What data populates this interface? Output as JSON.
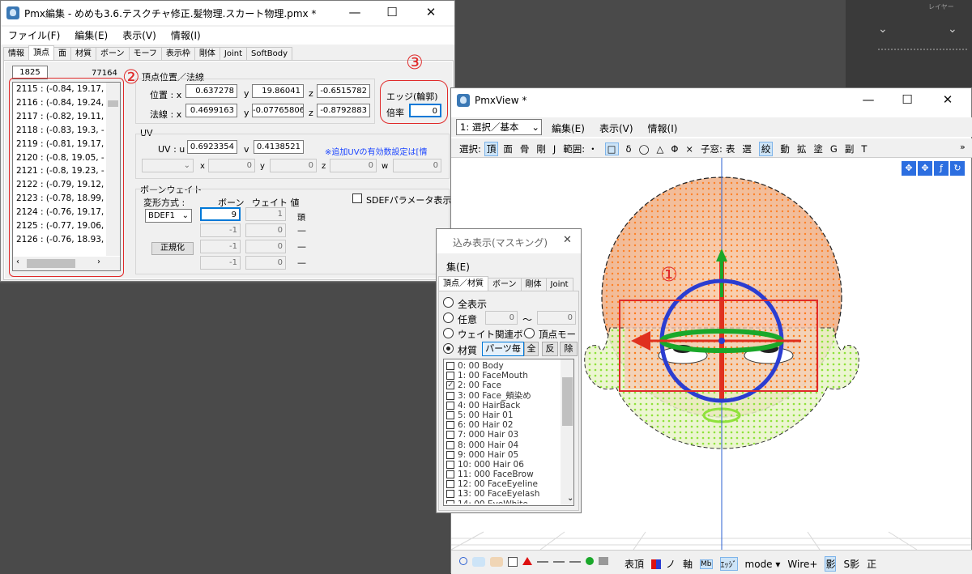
{
  "colors": {
    "annotation": "#e02a2a",
    "accent": "#0078d7"
  },
  "bg_panel": {
    "title": "レイヤー"
  },
  "pmx": {
    "title": "Pmx編集 - めめも3.6.テスクチャ修正.髪物理.スカート物理.pmx *",
    "menu": [
      "ファイル(F)",
      "編集(E)",
      "表示(V)",
      "情報(I)"
    ],
    "tabs": [
      "情報",
      "頂点",
      "面",
      "材質",
      "ボーン",
      "モーフ",
      "表示枠",
      "剛体",
      "Joint",
      "SoftBody"
    ],
    "index_value": "1825",
    "count": "77164",
    "vertices": [
      "2115 : (-0.84, 19.17, -",
      "2116 : (-0.84, 19.24, -",
      "2117 : (-0.82, 19.11, -",
      "2118 : (-0.83, 19.3, -",
      "2119 : (-0.81, 19.17, -",
      "2120 : (-0.8, 19.05, -",
      "2121 : (-0.8, 19.23, -",
      "2122 : (-0.79, 19.12, -",
      "2123 : (-0.78, 18.99, -",
      "2124 : (-0.76, 19.17, -",
      "2125 : (-0.77, 19.06, -",
      "2126 : (-0.76, 18.93, -"
    ],
    "pos": {
      "header": "頂点位置／法線",
      "pos_label": "位置 : x",
      "norm_label": "法線 : x",
      "x": "0.637278",
      "y": "19.86041",
      "z": "-0.6515782",
      "nx": "0.4699163",
      "ny": "-0.07765806",
      "nz": "-0.8792883"
    },
    "edge": {
      "label": "エッジ(輪郭)",
      "rate_label": "倍率",
      "rate": "0"
    },
    "uv": {
      "header": "UV",
      "label": "UV : u",
      "u": "0.6923354",
      "v": "0.4138521",
      "note": "※追加UVの有効数設定は[情",
      "x": "0",
      "y": "0",
      "z": "0",
      "w": "0"
    },
    "weight": {
      "header": "ボーンウェイト",
      "method_label": "変形方式 :",
      "bone_col": "ボーン",
      "weight_col": "ウェイト 値",
      "method": "BDEF1",
      "normalize": "正規化",
      "sdef": "SDEFパラメータ表示",
      "rows": [
        {
          "bone": "9",
          "w": "1",
          "name": "頭"
        },
        {
          "bone": "-1",
          "w": "0",
          "name": "—"
        },
        {
          "bone": "-1",
          "w": "0",
          "name": "—"
        },
        {
          "bone": "-1",
          "w": "0",
          "name": "—"
        }
      ]
    },
    "axis_labels": {
      "x": "x",
      "y": "y",
      "z": "z",
      "w": "w",
      "v": "v"
    }
  },
  "view": {
    "title": "PmxView *",
    "mode_select": "1: 選択／基本",
    "menu": [
      "編集(E)",
      "表示(V)",
      "情報(I)"
    ],
    "toolbar": [
      "選択:",
      "頂",
      "面",
      "骨",
      "剛",
      "J",
      "範囲:",
      "・",
      "□",
      "δ",
      "◯",
      "△",
      "Φ",
      "×",
      "子窓:",
      "表",
      "選",
      "絞",
      "動",
      "拡",
      "塗",
      "G",
      "副",
      "T"
    ],
    "bottom": [
      "表頂",
      "ノ",
      "軸",
      "Mb",
      "ｴｯｼﾞ",
      "mode ▾",
      "Wire+",
      "影",
      "S影",
      "正"
    ]
  },
  "mask": {
    "title": "込み表示(マスキング)",
    "menu": "集(E)",
    "tabs": [
      "頂点／材質",
      "ボーン",
      "剛体",
      "Joint"
    ],
    "all_label": "全表示",
    "any_label": "任意",
    "any_from": "0",
    "range_sep": "～",
    "any_to": "0",
    "weight_label": "ウェイト関連ボー",
    "vmorph_label": "頂点モー",
    "mat_label": "材質",
    "parts_btn": "パーツ毎",
    "btn_all": "全",
    "btn_inv": "反",
    "btn_rm": "除",
    "materials": [
      "0: 00 Body",
      "1: 00 FaceMouth",
      "2: 00 Face",
      "3: 00 Face_頬染め",
      "4: 00 HairBack",
      "5: 00 Hair 01",
      "6: 00 Hair 02",
      "7: 000 Hair 03",
      "8: 000 Hair 04",
      "9: 000 Hair 05",
      "10: 000 Hair 06",
      "11: 000 FaceBrow",
      "12: 00 FaceEyeline",
      "13: 00 FaceEyelash",
      "14: 00 EyeWhite"
    ],
    "checked_index": 2
  },
  "annotations": [
    "①",
    "②",
    "③"
  ]
}
